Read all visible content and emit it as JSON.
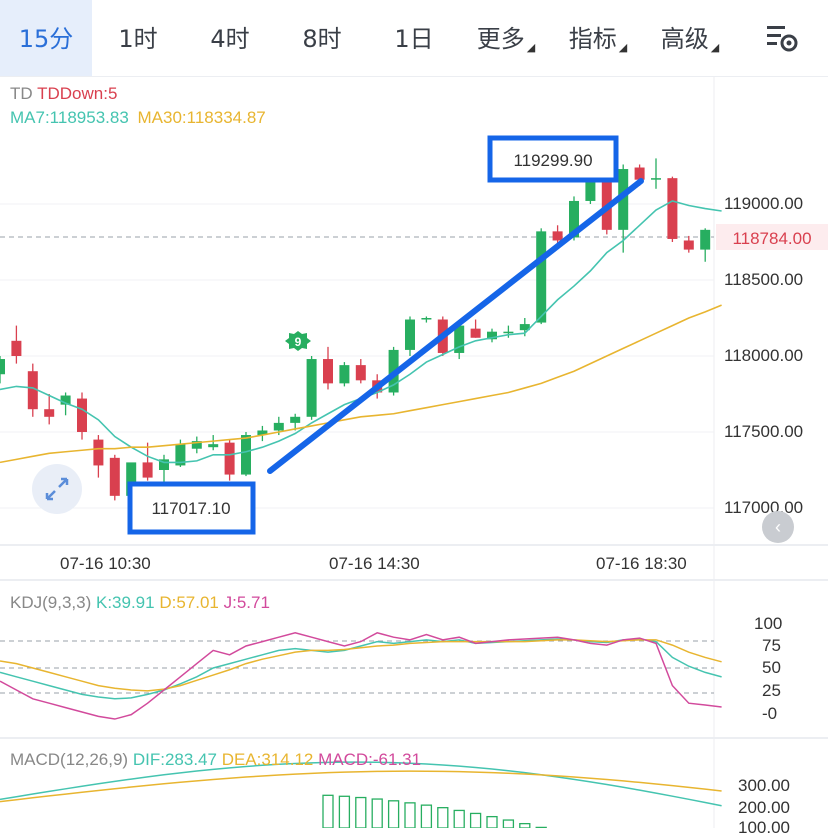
{
  "tabs": [
    {
      "label": "15分",
      "active": true
    },
    {
      "label": "1时"
    },
    {
      "label": "4时"
    },
    {
      "label": "8时"
    },
    {
      "label": "1日"
    },
    {
      "label": "更多",
      "dropdown": true
    },
    {
      "label": "指标",
      "dropdown": true
    },
    {
      "label": "高级",
      "dropdown": true
    }
  ],
  "settings_icon": "chart-settings-icon",
  "main_legend": {
    "td": "TD",
    "td_down": "TDDown:5",
    "ma7": "MA7:118953.83",
    "ma30": "MA30:118334.87"
  },
  "annotations": {
    "high_label": "119299.90",
    "low_label": "117017.10",
    "last_price": "118784.00",
    "td_marker": "9"
  },
  "price_axis": [
    "119000.00",
    "118500.00",
    "118000.00",
    "117500.00",
    "117000.00"
  ],
  "time_axis": [
    "07-16 10:30",
    "07-16 14:30",
    "07-16 18:30"
  ],
  "kdj": {
    "legend": {
      "name": "KDJ(9,3,3)",
      "k": "K:39.91",
      "d": "D:57.01",
      "j": "J:5.71"
    },
    "axis": [
      "100",
      "75",
      "50",
      "25",
      "-0"
    ]
  },
  "macd": {
    "legend": {
      "name": "MACD(12,26,9)",
      "dif": "DIF:283.47",
      "dea": "DEA:314.12",
      "macd": "MACD:-61.31"
    },
    "axis": [
      "300.00",
      "200.00",
      "100.00"
    ]
  },
  "colors": {
    "up": "#27ae60",
    "down": "#d9404f",
    "ma7": "#45c4b0",
    "ma30": "#e8b530",
    "j": "#d24a9c",
    "accent": "#2a6fd8",
    "trendline": "#1565e8"
  },
  "chart_data": [
    {
      "type": "candlestick",
      "title": "",
      "ylim": [
        116850,
        119400
      ],
      "x_labels": [
        "07-16 10:30",
        "07-16 14:30",
        "07-16 18:30"
      ],
      "candles": [
        {
          "o": 117880,
          "h": 118000,
          "l": 117820,
          "c": 117980
        },
        {
          "o": 118100,
          "h": 118200,
          "l": 117950,
          "c": 118000
        },
        {
          "o": 117900,
          "h": 117950,
          "l": 117600,
          "c": 117650
        },
        {
          "o": 117650,
          "h": 117750,
          "l": 117550,
          "c": 117600
        },
        {
          "o": 117680,
          "h": 117760,
          "l": 117610,
          "c": 117740
        },
        {
          "o": 117720,
          "h": 117760,
          "l": 117450,
          "c": 117500
        },
        {
          "o": 117450,
          "h": 117480,
          "l": 117200,
          "c": 117280
        },
        {
          "o": 117330,
          "h": 117350,
          "l": 117050,
          "c": 117080
        },
        {
          "o": 117080,
          "h": 117260,
          "l": 117017,
          "c": 117300
        },
        {
          "o": 117300,
          "h": 117430,
          "l": 117180,
          "c": 117200
        },
        {
          "o": 117250,
          "h": 117350,
          "l": 117150,
          "c": 117320
        },
        {
          "o": 117280,
          "h": 117450,
          "l": 117270,
          "c": 117420
        },
        {
          "o": 117390,
          "h": 117470,
          "l": 117360,
          "c": 117440
        },
        {
          "o": 117400,
          "h": 117480,
          "l": 117380,
          "c": 117420
        },
        {
          "o": 117430,
          "h": 117450,
          "l": 117180,
          "c": 117220
        },
        {
          "o": 117220,
          "h": 117500,
          "l": 117210,
          "c": 117480
        },
        {
          "o": 117480,
          "h": 117540,
          "l": 117440,
          "c": 117510
        },
        {
          "o": 117510,
          "h": 117600,
          "l": 117480,
          "c": 117560
        },
        {
          "o": 117560,
          "h": 117620,
          "l": 117510,
          "c": 117600
        },
        {
          "o": 117600,
          "h": 118000,
          "l": 117580,
          "c": 117980
        },
        {
          "o": 117980,
          "h": 118060,
          "l": 117780,
          "c": 117820
        },
        {
          "o": 117820,
          "h": 117960,
          "l": 117800,
          "c": 117940
        },
        {
          "o": 117940,
          "h": 117980,
          "l": 117820,
          "c": 117840
        },
        {
          "o": 117840,
          "h": 117880,
          "l": 117720,
          "c": 117760
        },
        {
          "o": 117760,
          "h": 118060,
          "l": 117740,
          "c": 118040
        },
        {
          "o": 118040,
          "h": 118260,
          "l": 118000,
          "c": 118240
        },
        {
          "o": 118240,
          "h": 118260,
          "l": 118220,
          "c": 118250
        },
        {
          "o": 118240,
          "h": 118260,
          "l": 118000,
          "c": 118020
        },
        {
          "o": 118020,
          "h": 118230,
          "l": 117980,
          "c": 118200
        },
        {
          "o": 118180,
          "h": 118240,
          "l": 118120,
          "c": 118120
        },
        {
          "o": 118110,
          "h": 118180,
          "l": 118090,
          "c": 118160
        },
        {
          "o": 118150,
          "h": 118200,
          "l": 118120,
          "c": 118160
        },
        {
          "o": 118170,
          "h": 118250,
          "l": 118130,
          "c": 118210
        },
        {
          "o": 118220,
          "h": 118840,
          "l": 118210,
          "c": 118820
        },
        {
          "o": 118820,
          "h": 118860,
          "l": 118740,
          "c": 118760
        },
        {
          "o": 118780,
          "h": 119050,
          "l": 118760,
          "c": 119020
        },
        {
          "o": 119020,
          "h": 119250,
          "l": 119000,
          "c": 119240
        },
        {
          "o": 119230,
          "h": 119280,
          "l": 118800,
          "c": 118830
        },
        {
          "o": 118830,
          "h": 119260,
          "l": 118680,
          "c": 119230
        },
        {
          "o": 119240,
          "h": 119260,
          "l": 119120,
          "c": 119160
        },
        {
          "o": 119160,
          "h": 119300,
          "l": 119100,
          "c": 119170
        },
        {
          "o": 119170,
          "h": 119180,
          "l": 118750,
          "c": 118770
        },
        {
          "o": 118760,
          "h": 118790,
          "l": 118680,
          "c": 118700
        },
        {
          "o": 118700,
          "h": 118840,
          "l": 118620,
          "c": 118830
        },
        {
          "o": 118830,
          "h": 118840,
          "l": 118740,
          "c": 118784
        }
      ],
      "series": [
        {
          "name": "MA7",
          "values": [
            117780,
            117800,
            117790,
            117740,
            117690,
            117650,
            117580,
            117470,
            117400,
            117340,
            117300,
            117300,
            117310,
            117350,
            117350,
            117370,
            117400,
            117440,
            117490,
            117560,
            117620,
            117680,
            117720,
            117760,
            117810,
            117880,
            117960,
            118010,
            118060,
            118100,
            118120,
            118140,
            118150,
            118260,
            118370,
            118460,
            118560,
            118680,
            118760,
            118860,
            118960,
            119020,
            118990,
            118970,
            118954
          ]
        },
        {
          "name": "MA30",
          "values": [
            117300,
            117320,
            117340,
            117360,
            117370,
            117380,
            117390,
            117390,
            117400,
            117400,
            117410,
            117420,
            117430,
            117440,
            117450,
            117460,
            117480,
            117500,
            117520,
            117540,
            117560,
            117580,
            117600,
            117610,
            117620,
            117640,
            117660,
            117680,
            117700,
            117720,
            117740,
            117760,
            117790,
            117820,
            117860,
            117900,
            117950,
            118000,
            118050,
            118100,
            118150,
            118200,
            118250,
            118290,
            118335
          ]
        }
      ]
    },
    {
      "type": "line",
      "title": "",
      "ylim": [
        -10,
        110
      ],
      "series": [
        {
          "name": "K",
          "values": [
            45,
            40,
            35,
            30,
            25,
            20,
            17,
            15,
            16,
            20,
            25,
            32,
            40,
            50,
            55,
            60,
            65,
            70,
            72,
            70,
            68,
            70,
            75,
            80,
            78,
            80,
            82,
            80,
            82,
            78,
            79,
            80,
            81,
            82,
            83,
            82,
            80,
            79,
            82,
            83,
            80,
            62,
            52,
            45,
            39.91
          ]
        },
        {
          "name": "D",
          "values": [
            58,
            55,
            50,
            45,
            40,
            35,
            30,
            27,
            25,
            24,
            26,
            30,
            36,
            42,
            48,
            55,
            60,
            64,
            68,
            70,
            70,
            71,
            73,
            75,
            76,
            78,
            79,
            80,
            80,
            80,
            80,
            80,
            80,
            81,
            82,
            82,
            81,
            80,
            81,
            82,
            82,
            76,
            68,
            62,
            57.01
          ]
        },
        {
          "name": "J",
          "values": [
            35,
            25,
            15,
            10,
            5,
            0,
            -5,
            -8,
            -3,
            10,
            25,
            40,
            55,
            70,
            65,
            75,
            80,
            85,
            90,
            85,
            80,
            75,
            80,
            90,
            85,
            82,
            88,
            82,
            85,
            78,
            80,
            82,
            83,
            84,
            85,
            82,
            78,
            76,
            82,
            84,
            78,
            30,
            10,
            8,
            5.71
          ]
        }
      ]
    },
    {
      "type": "bar",
      "title": "",
      "series": [
        {
          "name": "DIF",
          "values": [
            283.47
          ]
        },
        {
          "name": "DEA",
          "values": [
            314.12
          ]
        },
        {
          "name": "MACD",
          "values": [
            -61.31
          ]
        }
      ]
    }
  ]
}
